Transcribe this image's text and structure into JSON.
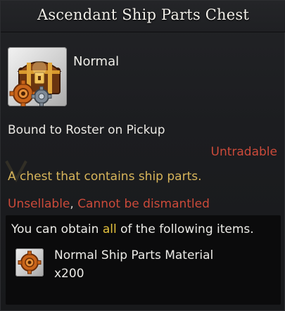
{
  "title": "Ascendant Ship Parts Chest",
  "item": {
    "grade": "Normal",
    "icon": "chest-with-gears-icon"
  },
  "bind": "Bound to Roster on Pickup",
  "trade": "Untradable",
  "description": "A chest that contains ship parts.",
  "restrictions": {
    "unsellable": "Unsellable",
    "separator": ", ",
    "cannot_dismantle": "Cannot be dismantled"
  },
  "rewards": {
    "intro_before": "You can obtain ",
    "intro_highlight": "all",
    "intro_after": " of the following items.",
    "items": [
      {
        "name": "Normal Ship Parts Material",
        "qty": "x200",
        "icon": "ship-parts-gear-icon"
      }
    ]
  },
  "colors": {
    "background": "#1a1b1d",
    "description": "#d8b55a",
    "warning": "#cc4a3a",
    "highlight": "#e4c23e",
    "icon_frame": "#cfcfcf"
  }
}
